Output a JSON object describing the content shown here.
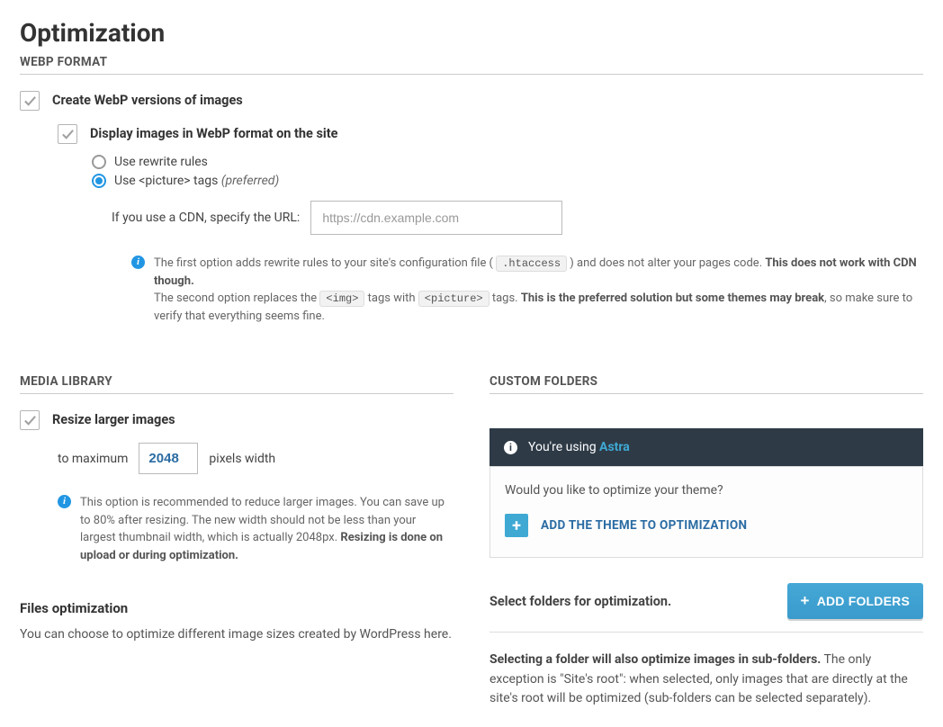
{
  "page": {
    "title": "Optimization"
  },
  "sections": {
    "webp": {
      "heading": "WEBP FORMAT",
      "create_label": "Create WebP versions of images",
      "display_label": "Display images in WebP format on the site",
      "radio_rewrite": "Use rewrite rules",
      "radio_picture_prefix": "Use ",
      "radio_picture_code": "<picture>",
      "radio_picture_suffix": " tags ",
      "radio_picture_pref": "(preferred)",
      "cdn_label": "If you use a CDN, specify the URL:",
      "cdn_placeholder": "https://cdn.example.com",
      "info": {
        "l1a": "The first option adds rewrite rules to your site's configuration file ( ",
        "l1code": ".htaccess",
        "l1b": " ) and does not alter your pages code. ",
        "l1bold": "This does not work with CDN though.",
        "l2a": "The second option replaces the ",
        "l2code1": "<img>",
        "l2b": " tags with ",
        "l2code2": "<picture>",
        "l2c": " tags. ",
        "l2bold": "This is the preferred solution but some themes may break",
        "l2d": ", so make sure to verify that everything seems fine."
      }
    },
    "media": {
      "heading": "MEDIA LIBRARY",
      "resize_label": "Resize larger images",
      "to_max": "to maximum",
      "width_value": "2048",
      "px_label": "pixels width",
      "info_a": "This option is recommended to reduce larger images. You can save up to 80% after resizing. The new width should not be less than your largest thumbnail width, which is actually 2048px. ",
      "info_bold": "Resizing is done on upload or during optimization."
    },
    "files_opt": {
      "title": "Files optimization",
      "desc": "You can choose to optimize different image sizes created by WordPress here."
    },
    "custom": {
      "heading": "CUSTOM FOLDERS",
      "banner_prefix": "You're using ",
      "banner_theme": "Astra",
      "box_q": "Would you like to optimize your theme?",
      "add_theme": "ADD THE THEME TO OPTIMIZATION",
      "select_folders": "Select folders for optimization.",
      "add_folders_btn": "ADD FOLDERS",
      "folders_desc_bold": "Selecting a folder will also optimize images in sub-folders.",
      "folders_desc_rest": " The only exception is \"Site's root\": when selected, only images that are directly at the site's root will be optimized (sub-folders can be selected separately)."
    }
  }
}
